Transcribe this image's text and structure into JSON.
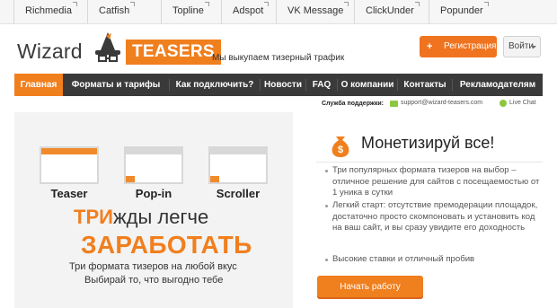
{
  "top_links": [
    {
      "label": "Richmedia"
    },
    {
      "label": "Catfish"
    },
    {
      "label": "Topline"
    },
    {
      "label": "Adspot"
    },
    {
      "label": "VK Message"
    },
    {
      "label": "ClickUnder"
    },
    {
      "label": "Popunder"
    }
  ],
  "header": {
    "logo_text": "Wizard",
    "logo_badge": "TEASERS",
    "tagline": "Мы выкупаем тизерный трафик",
    "register_plus": "+",
    "register_label": "Регистрация",
    "login_label": "Войти"
  },
  "nav": {
    "items": [
      {
        "label": "Главная",
        "active": true
      },
      {
        "label": "Форматы и тарифы",
        "active": false
      },
      {
        "label": "Как подключить?",
        "active": false
      },
      {
        "label": "Новости",
        "active": false
      },
      {
        "label": "FAQ",
        "active": false
      },
      {
        "label": "О компании",
        "active": false
      },
      {
        "label": "Контакты",
        "active": false
      },
      {
        "label": "Рекламодателям",
        "active": false
      }
    ],
    "accent_color": "#f07f1e",
    "bar_color": "#3a3a3a"
  },
  "support": {
    "label": "Служба поддержки:",
    "email": "support@wizard-teasers.com",
    "chat": "Live Chat"
  },
  "promo": {
    "formats": [
      {
        "label": "Teaser"
      },
      {
        "label": "Pop-in"
      },
      {
        "label": "Scroller"
      }
    ],
    "headline_accent": "ТРИ",
    "headline_rest": "жды легче",
    "headline_big": "ЗАРАБОТАТЬ",
    "sub1": "Три формата тизеров на любой вкус",
    "sub2": "Выбирай то, что выгодно тебе"
  },
  "monetize": {
    "title": "Монетизируй все!",
    "bullets": [
      "Три популярных формата тизеров на выбор – отличное решение для сайтов с посещаемостью от 1 уника в сутки",
      "Легкий старт: отсутствие премодерации площадок, достаточно просто скомпоновать и установить код на ваш сайт, и вы сразу увидите его доходность",
      "Высокие ставки и отличный пробив"
    ],
    "cta": "Начать работу"
  }
}
